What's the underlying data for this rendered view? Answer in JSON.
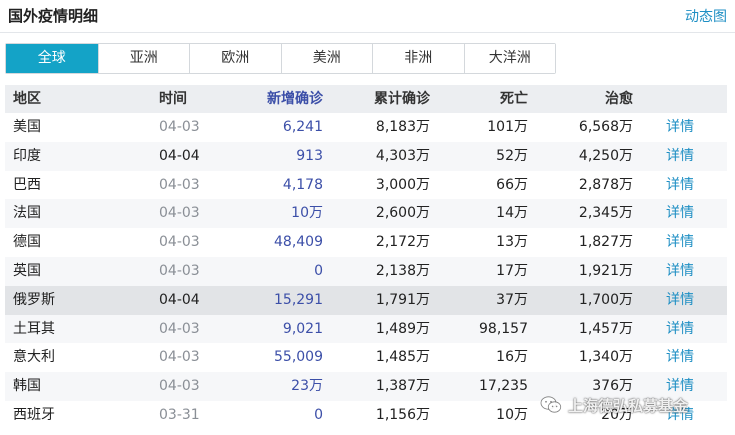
{
  "header": {
    "title": "国外疫情明细",
    "link": "动态图"
  },
  "tabs": [
    {
      "label": "全球",
      "active": true
    },
    {
      "label": "亚洲",
      "active": false
    },
    {
      "label": "欧洲",
      "active": false
    },
    {
      "label": "美洲",
      "active": false
    },
    {
      "label": "非洲",
      "active": false
    },
    {
      "label": "大洋洲",
      "active": false
    }
  ],
  "table": {
    "headers": {
      "region": "地区",
      "time": "时间",
      "new": "新增确诊",
      "total": "累计确诊",
      "dead": "死亡",
      "cured": "治愈"
    },
    "rows": [
      {
        "region": "美国",
        "time": "04-03",
        "new": "6,241",
        "total": "8,183万",
        "dead": "101万",
        "cured": "6,568万",
        "detail": "详情"
      },
      {
        "region": "印度",
        "time": "04-04",
        "new": "913",
        "total": "4,303万",
        "dead": "52万",
        "cured": "4,250万",
        "detail": "详情"
      },
      {
        "region": "巴西",
        "time": "04-03",
        "new": "4,178",
        "total": "3,000万",
        "dead": "66万",
        "cured": "2,878万",
        "detail": "详情"
      },
      {
        "region": "法国",
        "time": "04-03",
        "new": "10万",
        "total": "2,600万",
        "dead": "14万",
        "cured": "2,345万",
        "detail": "详情"
      },
      {
        "region": "德国",
        "time": "04-03",
        "new": "48,409",
        "total": "2,172万",
        "dead": "13万",
        "cured": "1,827万",
        "detail": "详情"
      },
      {
        "region": "英国",
        "time": "04-03",
        "new": "0",
        "total": "2,138万",
        "dead": "17万",
        "cured": "1,921万",
        "detail": "详情"
      },
      {
        "region": "俄罗斯",
        "time": "04-04",
        "new": "15,291",
        "total": "1,791万",
        "dead": "37万",
        "cured": "1,700万",
        "detail": "详情"
      },
      {
        "region": "土耳其",
        "time": "04-03",
        "new": "9,021",
        "total": "1,489万",
        "dead": "98,157",
        "cured": "1,457万",
        "detail": "详情"
      },
      {
        "region": "意大利",
        "time": "04-03",
        "new": "55,009",
        "total": "1,485万",
        "dead": "16万",
        "cured": "1,340万",
        "detail": "详情"
      },
      {
        "region": "韩国",
        "time": "04-03",
        "new": "23万",
        "total": "1,387万",
        "dead": "17,235",
        "cured": "376万",
        "detail": "详情"
      },
      {
        "region": "西班牙",
        "time": "03-31",
        "new": "0",
        "total": "1,156万",
        "dead": "10万",
        "cured": "20万",
        "detail": "详情"
      }
    ]
  },
  "watermark": {
    "text": "上海德弘私募基金"
  },
  "colors": {
    "accent": "#14a3c7",
    "link": "#1f8fc4",
    "new_cases": "#3c4fa8"
  }
}
